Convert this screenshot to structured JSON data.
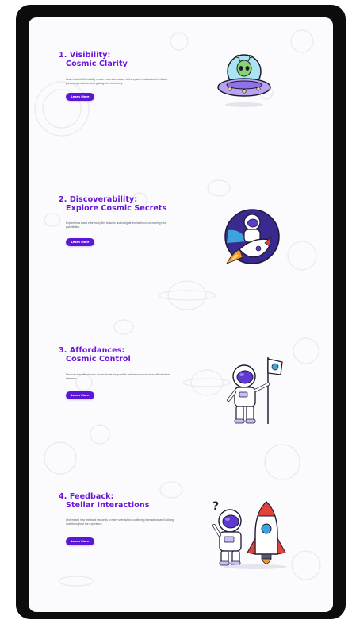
{
  "sections": [
    {
      "title_line1": "1. Visibility:",
      "title_line2": "Cosmic Clarity",
      "description": "Learn how UI/UX visibility ensures users are aware of the system's status and feedback, preventing confusion and guiding them intuitively.",
      "button_label": "Learn More",
      "illustration": "alien-ufo-icon"
    },
    {
      "title_line1": "2. Discoverability:",
      "title_line2": "Explore Cosmic Secrets",
      "description": "Explore how users effortlessly find features and navigate the interface, uncovering new possibilities.",
      "button_label": "Learn More",
      "illustration": "astronaut-rocket-icon"
    },
    {
      "title_line1": "3. Affordances:",
      "title_line2": "Cosmic Control",
      "description": "Discover how affordances communicate the possible actions users can take with interface elements.",
      "button_label": "Learn More",
      "illustration": "astronaut-flag-icon"
    },
    {
      "title_line1": "4. Feedback:",
      "title_line2": "Stellar Interactions",
      "description": "Understand how feedback responds to every user action, confirming interactions and building trust throughout the experience.",
      "button_label": "Learn More",
      "illustration": "astronaut-question-rocket-icon"
    }
  ],
  "colors": {
    "title": "#6a16d8",
    "button": "#5a17d6",
    "text": "#555a66",
    "device_frame": "#0c0c0c",
    "screen_bg": "#fbfbfd"
  }
}
